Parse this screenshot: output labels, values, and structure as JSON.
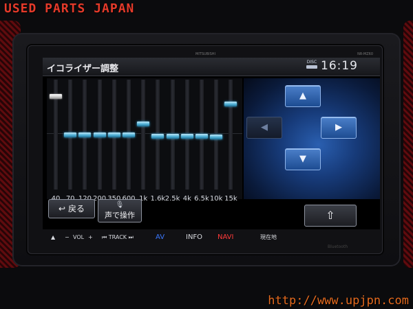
{
  "watermark": {
    "top": "USED PARTS JAPAN",
    "bottom": "http://www.upjpn.com"
  },
  "device": {
    "brand": "MITSUBISHI",
    "model": "NR-MZ60"
  },
  "screen": {
    "title": "イコライザー調整",
    "disc_label": "DISC",
    "clock": "16:19"
  },
  "equalizer": {
    "bands": [
      {
        "freq": "40",
        "level": 0.85,
        "selected": true
      },
      {
        "freq": "70",
        "level": 0.5,
        "selected": false
      },
      {
        "freq": "120",
        "level": 0.5,
        "selected": false
      },
      {
        "freq": "200",
        "level": 0.5,
        "selected": false
      },
      {
        "freq": "350",
        "level": 0.5,
        "selected": false
      },
      {
        "freq": "600",
        "level": 0.5,
        "selected": false
      },
      {
        "freq": "1k",
        "level": 0.6,
        "selected": false
      },
      {
        "freq": "1.6k",
        "level": 0.49,
        "selected": false
      },
      {
        "freq": "2.5k",
        "level": 0.49,
        "selected": false
      },
      {
        "freq": "4k",
        "level": 0.49,
        "selected": false
      },
      {
        "freq": "6.5k",
        "level": 0.49,
        "selected": false
      },
      {
        "freq": "10k",
        "level": 0.48,
        "selected": false
      },
      {
        "freq": "15k",
        "level": 0.78,
        "selected": false
      }
    ],
    "accent_color": "#4fb0d6",
    "selected_color": "#ffffff"
  },
  "controls": {
    "up": "▲",
    "down": "▼",
    "left": "◀",
    "right": "▶",
    "back_label": "戻る",
    "back_icon": "↩",
    "voice_label": "声で操作",
    "voice_icon": "mic-icon",
    "home_icon": "⇧"
  },
  "hardware": {
    "eject": "▲",
    "vol_minus": "−",
    "vol": "VOL",
    "vol_plus": "+",
    "track": "⏮ TRACK ⏭",
    "av": "AV",
    "info": "INFO",
    "navi": "NAVI",
    "current": "現在地",
    "bluetooth": "Bluetooth"
  }
}
